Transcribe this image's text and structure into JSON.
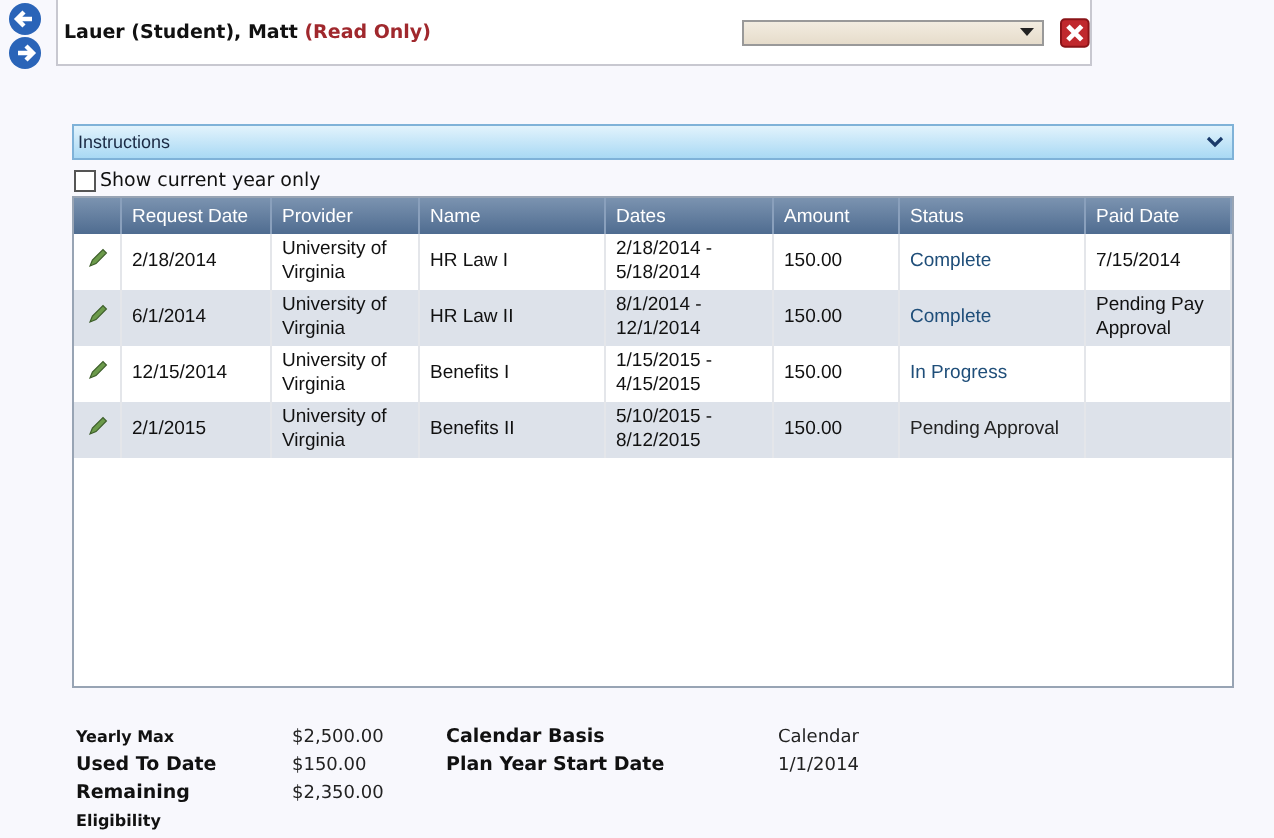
{
  "header": {
    "name": "Lauer (Student), Matt",
    "mode": "(Read Only)"
  },
  "instructions": {
    "title": "Instructions",
    "expanded": false
  },
  "filter": {
    "label": "Show current year only",
    "checked": false
  },
  "table": {
    "columns": [
      "Request Date",
      "Provider",
      "Name",
      "Dates",
      "Amount",
      "Status",
      "Paid Date"
    ],
    "rows": [
      {
        "request_date": "2/18/2014",
        "provider": "University of Virginia",
        "name": "HR Law I",
        "dates": "2/18/2014 - 5/18/2014",
        "amount": "150.00",
        "status": "Complete",
        "color": "#1f4e79",
        "paid_date": "7/15/2014"
      },
      {
        "request_date": "6/1/2014",
        "provider": "University of Virginia",
        "name": "HR Law II",
        "dates": "8/1/2014 - 12/1/2014",
        "amount": "150.00",
        "status": "Complete",
        "color": "#1f4e79",
        "paid_date": "Pending Pay Approval"
      },
      {
        "request_date": "12/15/2014",
        "provider": "University of Virginia",
        "name": "Benefits I",
        "dates": "1/15/2015 - 4/15/2015",
        "amount": "150.00",
        "status": "In Progress",
        "color": "#1f4e79"
      },
      {
        "request_date": "2/1/2015",
        "provider": "University of Virginia",
        "name": "Benefits II",
        "dates": "5/10/2015 - 8/12/2015",
        "amount": "150.00",
        "status": "Pending Approval",
        "color": "#222222"
      }
    ]
  },
  "summary": {
    "left": [
      {
        "label": "Yearly Max",
        "value": "$2,500.00"
      },
      {
        "label": "Used To Date",
        "value": "$150.00"
      },
      {
        "label": "Remaining",
        "value": "$2,350.00"
      },
      {
        "label": "Eligibility"
      }
    ],
    "right": [
      {
        "label": "Calendar Basis",
        "value": "Calendar"
      },
      {
        "label": "Plan Year Start Date",
        "value": "1/1/2014"
      }
    ]
  }
}
